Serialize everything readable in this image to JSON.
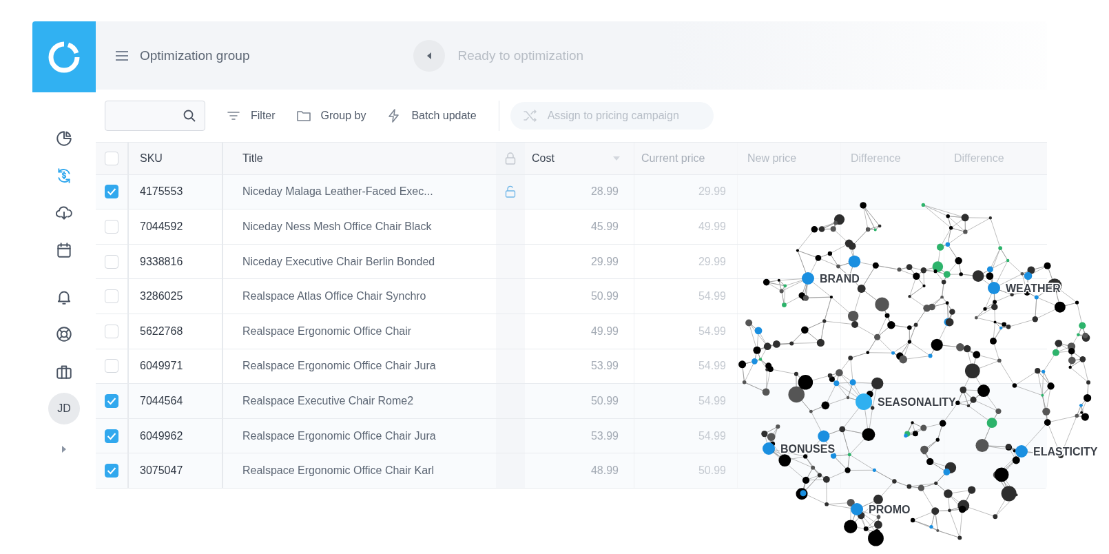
{
  "sidebar": {
    "items": [
      {
        "selected": false
      },
      {
        "selected": true
      },
      {
        "selected": false
      },
      {
        "selected": false
      },
      {
        "selected": false
      },
      {
        "selected": false
      },
      {
        "selected": false
      }
    ],
    "avatar": "JD"
  },
  "header": {
    "title": "Optimization group",
    "status": "Ready to optimization"
  },
  "toolbar": {
    "actions": [
      {
        "label": "Filter",
        "disabled": false
      },
      {
        "label": "Group by",
        "disabled": false
      },
      {
        "label": "Batch update",
        "disabled": false
      },
      {
        "label": "Assign to pricing campaign",
        "disabled": true
      }
    ]
  },
  "table": {
    "all_checked": false,
    "columns": [
      "SKU",
      "Title",
      "Cost",
      "Current price",
      "New price",
      "Difference",
      "Difference"
    ],
    "rows": [
      {
        "checked": true,
        "sku": "4175553",
        "title": "Niceday Malaga Leather-Faced Exec...",
        "locked": true,
        "cost": "28.99",
        "current_price": "29.99"
      },
      {
        "checked": false,
        "sku": "7044592",
        "title": "Niceday Ness Mesh Office Chair Black",
        "locked": false,
        "cost": "45.99",
        "current_price": "49.99"
      },
      {
        "checked": false,
        "sku": "9338816",
        "title": "Niceday Executive Chair Berlin Bonded",
        "locked": false,
        "cost": "29.99",
        "current_price": "29.99"
      },
      {
        "checked": false,
        "sku": "3286025",
        "title": "Realspace Atlas Office Chair Synchro",
        "locked": false,
        "cost": "50.99",
        "current_price": "54.99"
      },
      {
        "checked": false,
        "sku": "5622768",
        "title": "Realspace Ergonomic Office Chair",
        "locked": false,
        "cost": "49.99",
        "current_price": "54.99"
      },
      {
        "checked": false,
        "sku": "6049971",
        "title": "Realspace Ergonomic Office Chair Jura",
        "locked": false,
        "cost": "53.99",
        "current_price": "54.99"
      },
      {
        "checked": true,
        "sku": "7044564",
        "title": "Realspace Executive Chair Rome2",
        "locked": false,
        "cost": "50.99",
        "current_price": "54.99"
      },
      {
        "checked": true,
        "sku": "6049962",
        "title": "Realspace Ergonomic Office Chair Jura",
        "locked": false,
        "cost": "53.99",
        "current_price": "54.99"
      },
      {
        "checked": true,
        "sku": "3075047",
        "title": "Realspace Ergonomic Office Chair Karl",
        "locked": false,
        "cost": "48.99",
        "current_price": "50.99"
      }
    ]
  },
  "graph": {
    "labels": [
      "BRAND",
      "WEATHER",
      "SEASONALITY",
      "BONUSES",
      "ELASTICITY",
      "PROMO"
    ]
  }
}
